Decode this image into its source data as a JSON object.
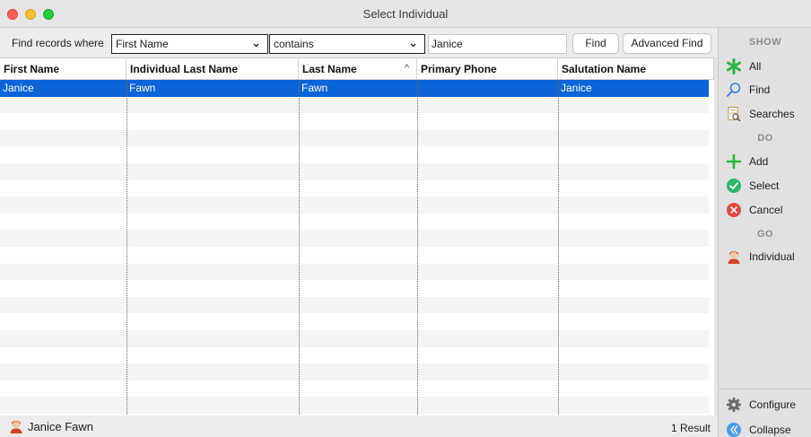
{
  "window": {
    "title": "Select Individual"
  },
  "findbar": {
    "label": "Find records where",
    "field_value": "First Name",
    "operator_value": "contains",
    "search_value": "Janice",
    "find_button": "Find",
    "advanced_find_button": "Advanced Find"
  },
  "table": {
    "columns": [
      "First Name",
      "Individual Last Name",
      "Last Name",
      "Primary Phone",
      "Salutation Name"
    ],
    "sort_indicator": "^",
    "rows": [
      {
        "first_name": "Janice",
        "individual_last_name": "Fawn",
        "last_name": "Fawn",
        "primary_phone": "",
        "salutation_name": "Janice"
      }
    ]
  },
  "status": {
    "selected_name": "Janice Fawn",
    "result_count": "1 Result"
  },
  "sidebar": {
    "show_heading": "SHOW",
    "show_items": [
      {
        "label": "All",
        "icon": "asterisk-icon"
      },
      {
        "label": "Find",
        "icon": "magnifier-icon"
      },
      {
        "label": "Searches",
        "icon": "searches-icon"
      }
    ],
    "do_heading": "DO",
    "do_items": [
      {
        "label": "Add",
        "icon": "plus-icon"
      },
      {
        "label": "Select",
        "icon": "checkmark-icon"
      },
      {
        "label": "Cancel",
        "icon": "cancel-icon"
      }
    ],
    "go_heading": "GO",
    "go_items": [
      {
        "label": "Individual",
        "icon": "person-icon"
      }
    ],
    "configure_label": "Configure",
    "collapse_label": "Collapse"
  },
  "colors": {
    "selection": "#0b64d8",
    "add_green": "#2fb344",
    "select_green": "#2fb36b",
    "cancel_red": "#e2483d",
    "collapse_blue": "#4a9cf0"
  }
}
